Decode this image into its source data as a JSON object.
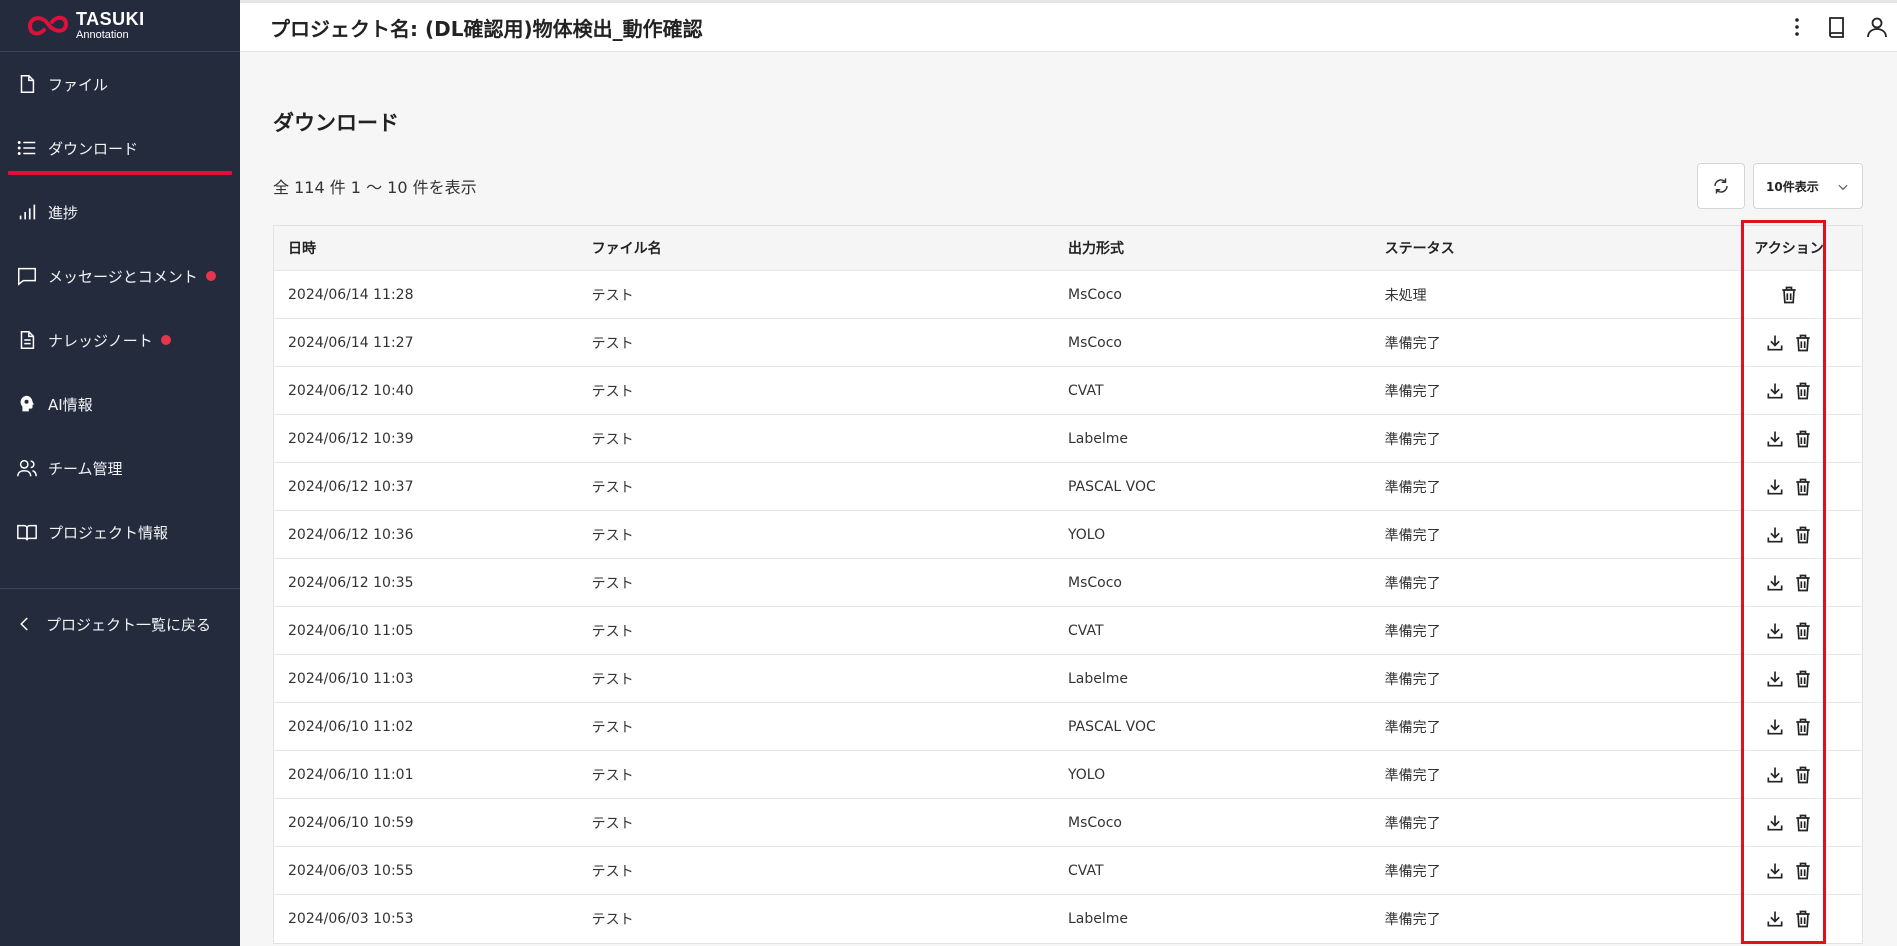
{
  "app": {
    "logo_name": "TASUKI",
    "logo_sub": "Annotation"
  },
  "sidebar": {
    "items": [
      {
        "label": "ファイル",
        "icon": "file-icon"
      },
      {
        "label": "ダウンロード",
        "icon": "list-icon"
      },
      {
        "label": "進捗",
        "icon": "bar-chart-icon"
      },
      {
        "label": "メッセージとコメント",
        "icon": "message-icon"
      },
      {
        "label": "ナレッジノート",
        "icon": "document-icon"
      },
      {
        "label": "AI情報",
        "icon": "ai-head-icon"
      },
      {
        "label": "チーム管理",
        "icon": "users-icon"
      },
      {
        "label": "プロジェクト情報",
        "icon": "book-icon"
      }
    ],
    "back_label": "プロジェクト一覧に戻る"
  },
  "header": {
    "title": "プロジェクト名: (DL確認用)物体検出_動作確認"
  },
  "main": {
    "heading": "ダウンロード",
    "count_text": "全 114 件 1 〜 10 件を表示",
    "per_page": "10件表示"
  },
  "table": {
    "columns": [
      "日時",
      "ファイル名",
      "出力形式",
      "ステータス",
      "アクション"
    ],
    "rows": [
      {
        "date": "2024/06/14 11:28",
        "file": "テスト",
        "format": "MsCoco",
        "status": "未処理"
      },
      {
        "date": "2024/06/14 11:27",
        "file": "テスト",
        "format": "MsCoco",
        "status": "準備完了"
      },
      {
        "date": "2024/06/12 10:40",
        "file": "テスト",
        "format": "CVAT",
        "status": "準備完了"
      },
      {
        "date": "2024/06/12 10:39",
        "file": "テスト",
        "format": "Labelme",
        "status": "準備完了"
      },
      {
        "date": "2024/06/12 10:37",
        "file": "テスト",
        "format": "PASCAL VOC",
        "status": "準備完了"
      },
      {
        "date": "2024/06/12 10:36",
        "file": "テスト",
        "format": "YOLO",
        "status": "準備完了"
      },
      {
        "date": "2024/06/12 10:35",
        "file": "テスト",
        "format": "MsCoco",
        "status": "準備完了"
      },
      {
        "date": "2024/06/10 11:05",
        "file": "テスト",
        "format": "CVAT",
        "status": "準備完了"
      },
      {
        "date": "2024/06/10 11:03",
        "file": "テスト",
        "format": "Labelme",
        "status": "準備完了"
      },
      {
        "date": "2024/06/10 11:02",
        "file": "テスト",
        "format": "PASCAL VOC",
        "status": "準備完了"
      },
      {
        "date": "2024/06/10 11:01",
        "file": "テスト",
        "format": "YOLO",
        "status": "準備完了"
      },
      {
        "date": "2024/06/10 10:59",
        "file": "テスト",
        "format": "MsCoco",
        "status": "準備完了"
      },
      {
        "date": "2024/06/03 10:55",
        "file": "テスト",
        "format": "CVAT",
        "status": "準備完了"
      },
      {
        "date": "2024/06/03 10:53",
        "file": "テスト",
        "format": "Labelme",
        "status": "準備完了"
      }
    ]
  },
  "colors": {
    "sidebar_bg": "#232b3d",
    "accent": "#e0103d",
    "highlight": "#e2101c"
  }
}
